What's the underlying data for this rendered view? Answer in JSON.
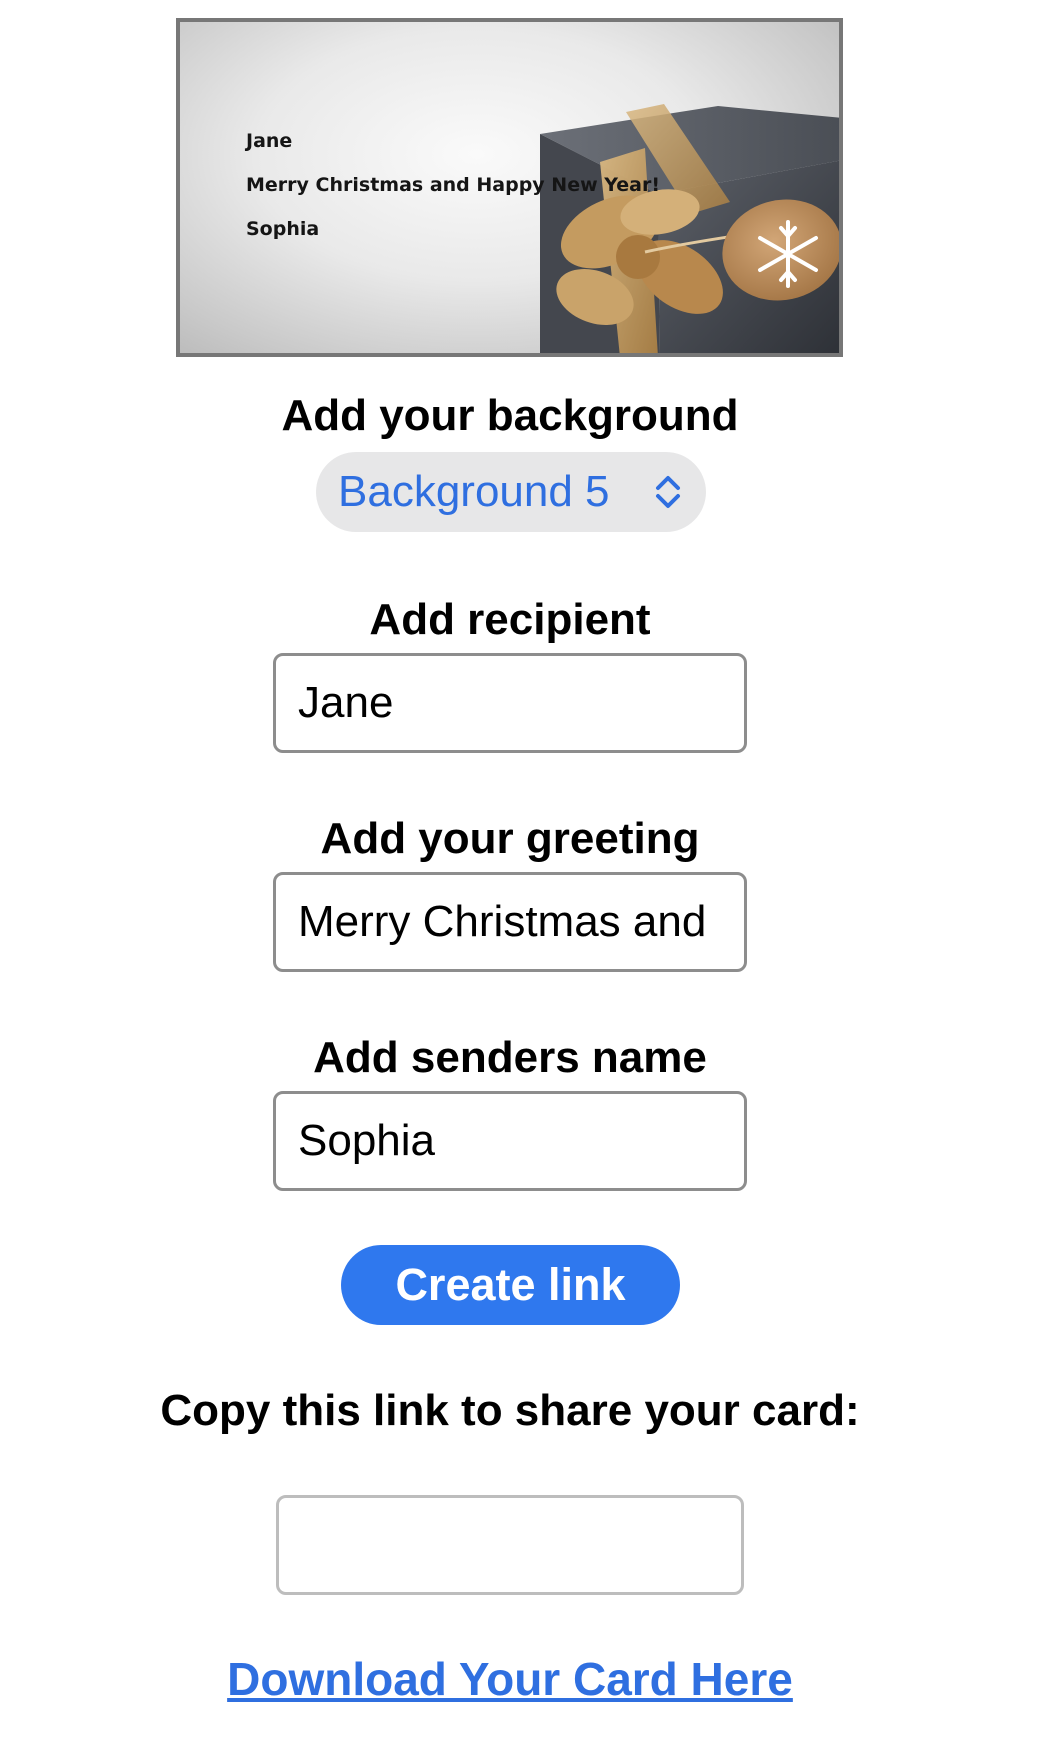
{
  "card": {
    "recipient": "Jane",
    "greeting": "Merry Christmas and Happy New Year!",
    "sender": "Sophia",
    "image_icon": "gift-box-with-bow-and-snowflake-tag"
  },
  "background_section": {
    "label": "Add your background",
    "selected": "Background 5",
    "chevron_icon": "up-down-chevron-icon"
  },
  "recipient_section": {
    "label": "Add recipient",
    "value": "Jane"
  },
  "greeting_section": {
    "label": "Add your greeting",
    "value": "Merry Christmas and Happy New Year!"
  },
  "sender_section": {
    "label": "Add senders name",
    "value": "Sophia"
  },
  "create_button": {
    "label": "Create link"
  },
  "share_section": {
    "label": "Copy this link to share your card:",
    "value": ""
  },
  "download_link": {
    "label": "Download Your Card Here"
  },
  "colors": {
    "accent": "#2f78ee",
    "link": "#2f6fe0",
    "select_background": "#e7e7e8",
    "border": "#8d8d8d"
  }
}
